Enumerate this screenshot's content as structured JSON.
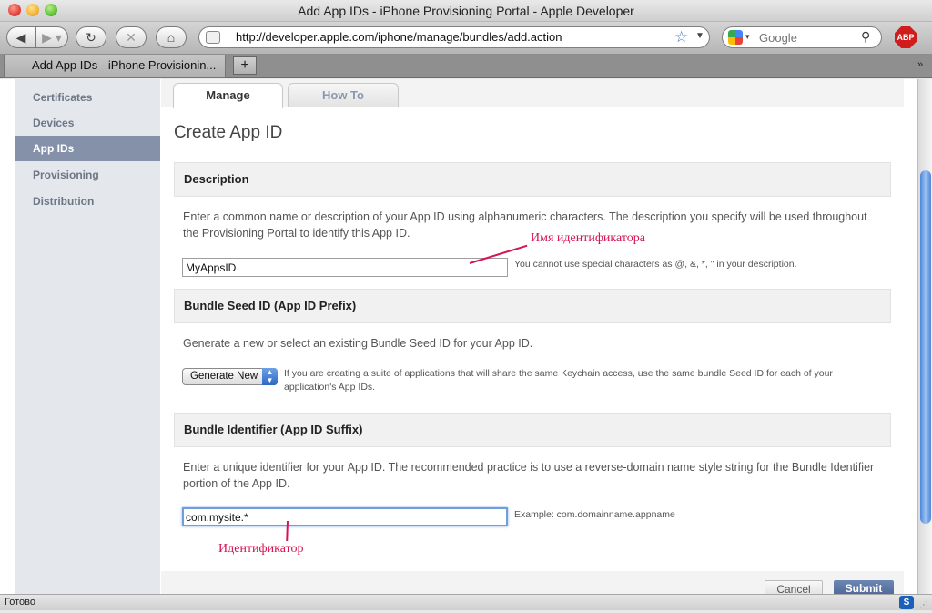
{
  "window": {
    "title": "Add App IDs - iPhone Provisioning Portal - Apple Developer"
  },
  "toolbar": {
    "url": "http://developer.apple.com/iphone/manage/bundles/add.action",
    "search_placeholder": "Google",
    "adblock_label": "ABP"
  },
  "tabs_bar": {
    "active_tab_title": "Add App IDs - iPhone Provisionin...",
    "new_tab_label": "+"
  },
  "sidebar": {
    "items": [
      {
        "label": "Certificates"
      },
      {
        "label": "Devices"
      },
      {
        "label": "App IDs"
      },
      {
        "label": "Provisioning"
      },
      {
        "label": "Distribution"
      }
    ],
    "active_index": 2
  },
  "page_tabs": {
    "manage": "Manage",
    "howto": "How To"
  },
  "page": {
    "title": "Create App ID",
    "description": {
      "heading": "Description",
      "text": "Enter a common name or description of your App ID using alphanumeric characters. The description you specify will be used throughout the Provisioning Portal to identify this App ID.",
      "value": "MyAppsID",
      "hint": "You cannot use special characters as @, &, *, \" in your description."
    },
    "seed": {
      "heading": "Bundle Seed ID (App ID Prefix)",
      "text": "Generate a new or select an existing Bundle Seed ID for your App ID.",
      "selected": "Generate New",
      "hint": "If you are creating a suite of applications that will share the same Keychain access, use the same bundle Seed ID for each of your application's App IDs."
    },
    "bundle": {
      "heading": "Bundle Identifier (App ID Suffix)",
      "text": "Enter a unique identifier for your App ID. The recommended practice is to use a reverse-domain name style string for the Bundle Identifier portion of the App ID.",
      "value": "com.mysite.*",
      "hint": "Example: com.domainname.appname"
    },
    "buttons": {
      "cancel": "Cancel",
      "submit": "Submit"
    }
  },
  "annotations": {
    "name_label": "Имя идентификатора",
    "id_label": "Идентификатор"
  },
  "statusbar": {
    "text": "Готово"
  },
  "colors": {
    "annotation": "#d51450",
    "sidebar_active": "#8591a8",
    "submit": "#4d6695"
  }
}
